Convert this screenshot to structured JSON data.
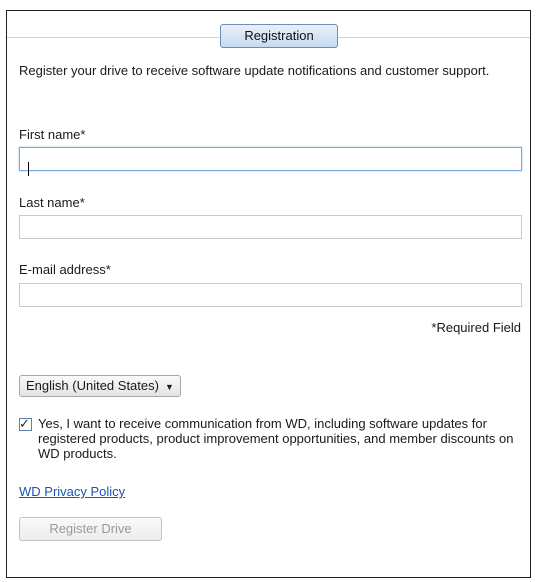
{
  "tab": {
    "label": "Registration"
  },
  "intro": "Register your drive to receive software update notifications and customer support.",
  "form": {
    "first_name_label": "First name*",
    "first_name_value": "",
    "last_name_label": "Last name*",
    "last_name_value": "",
    "email_label": "E-mail address*",
    "email_value": "",
    "required_note": "*Required Field"
  },
  "language": {
    "selected": "English (United States)"
  },
  "consent": {
    "checked": true,
    "text": "Yes, I want to receive communication from WD, including software updates for registered products, product improvement opportunities, and member discounts on WD products."
  },
  "privacy_link": "WD Privacy Policy",
  "register_button": {
    "label": "Register Drive",
    "enabled": false
  },
  "icons": {
    "dropdown": "chevron-down-icon",
    "checkmark": "checkmark-icon"
  },
  "colors": {
    "link": "#1b53b8",
    "tab_border": "#6c8fb5",
    "focus": "#7aa7d9"
  }
}
